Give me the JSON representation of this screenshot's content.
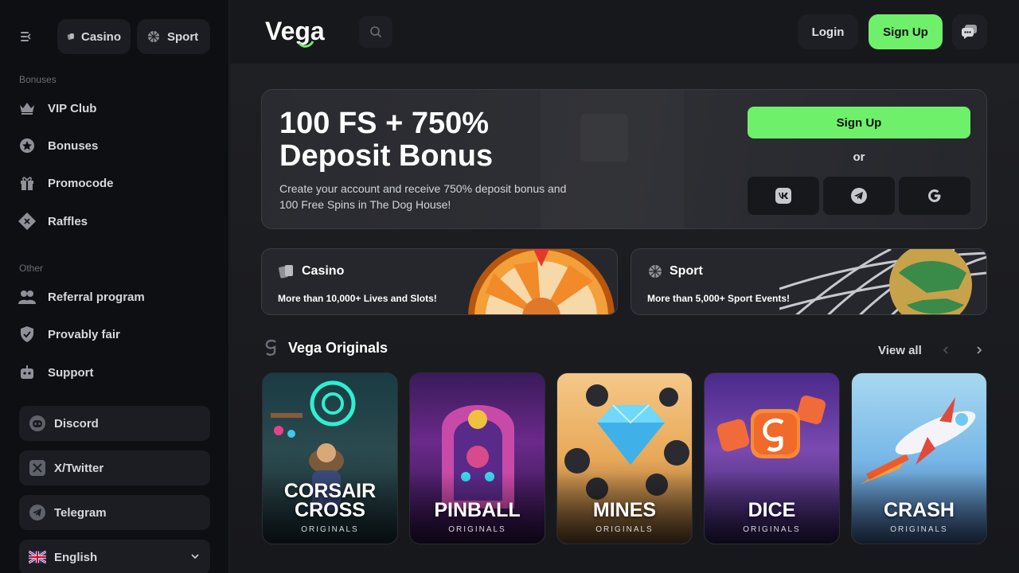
{
  "brand": {
    "logo_text": "Vega",
    "accent": "#6ef06a"
  },
  "sidebar": {
    "tabs": [
      {
        "label": "Casino",
        "icon": "cards-icon"
      },
      {
        "label": "Sport",
        "icon": "ball-icon"
      }
    ],
    "bonuses_heading": "Bonuses",
    "bonuses": [
      {
        "label": "VIP Club",
        "icon": "crown-icon"
      },
      {
        "label": "Bonuses",
        "icon": "star-badge-icon"
      },
      {
        "label": "Promocode",
        "icon": "gift-icon"
      },
      {
        "label": "Raffles",
        "icon": "ticket-icon"
      }
    ],
    "other_heading": "Other",
    "other": [
      {
        "label": "Referral program",
        "icon": "users-icon"
      },
      {
        "label": "Provably fair",
        "icon": "shield-icon"
      },
      {
        "label": "Support",
        "icon": "robot-icon"
      }
    ],
    "socials": [
      {
        "label": "Discord",
        "icon": "discord-icon"
      },
      {
        "label": "X/Twitter",
        "icon": "x-icon"
      },
      {
        "label": "Telegram",
        "icon": "telegram-icon"
      }
    ],
    "language": {
      "label": "English",
      "icon": "uk-flag-icon"
    }
  },
  "header": {
    "login": "Login",
    "signup": "Sign Up"
  },
  "hero": {
    "title_line1": "100 FS + 750%",
    "title_line2": "Deposit Bonus",
    "description": "Create your account and receive 750% deposit bonus and 100 Free Spins in The Dog House!",
    "signup": "Sign Up",
    "or": "or"
  },
  "categories": [
    {
      "title": "Casino",
      "subtitle": "More than 10,000+ Lives and Slots!"
    },
    {
      "title": "Sport",
      "subtitle": "More than 5,000+ Sport Events!"
    }
  ],
  "originals": {
    "heading": "Vega Originals",
    "view_all": "View all",
    "games": [
      {
        "name_line1": "CORSAIR",
        "name_line2": "CROSS",
        "tag": "ORIGINALS"
      },
      {
        "name_line1": "PINBALL",
        "name_line2": "",
        "tag": "ORIGINALS"
      },
      {
        "name_line1": "MINES",
        "name_line2": "",
        "tag": "ORIGINALS"
      },
      {
        "name_line1": "DICE",
        "name_line2": "",
        "tag": "ORIGINALS"
      },
      {
        "name_line1": "CRASH",
        "name_line2": "",
        "tag": "ORIGINALS"
      }
    ]
  }
}
